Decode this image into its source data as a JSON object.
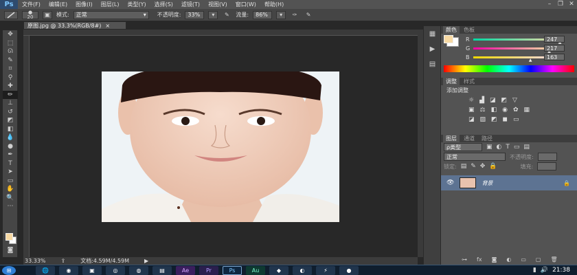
{
  "menubar": {
    "logo": "Ps",
    "items": [
      "文件(F)",
      "编辑(E)",
      "图像(I)",
      "图层(L)",
      "类型(Y)",
      "选择(S)",
      "滤镜(T)",
      "视图(V)",
      "窗口(W)",
      "帮助(H)"
    ],
    "window_buttons": [
      "–",
      "❐",
      "✕"
    ]
  },
  "options_bar": {
    "brush_size": "20",
    "mode_label": "模式:",
    "mode_value": "正常",
    "opacity_label": "不透明度:",
    "opacity_value": "33%",
    "flow_label": "流量:",
    "flow_value": "86%"
  },
  "document": {
    "tab_title": "原图.jpg @ 33.3%(RGB/8#)",
    "close": "×",
    "zoom": "33.33%",
    "doc_info": "文档:4.59M/4.59M"
  },
  "color_panel": {
    "tabs": [
      "颜色",
      "色板"
    ],
    "channels": [
      {
        "label": "R",
        "value": "247",
        "level": 0.97
      },
      {
        "label": "G",
        "value": "217",
        "level": 0.85
      },
      {
        "label": "B",
        "value": "163",
        "level": 0.64
      }
    ],
    "foreground": "#f7d9a3"
  },
  "adjustments_panel": {
    "tabs": [
      "调整",
      "样式"
    ],
    "title": "添加调整"
  },
  "layers_panel": {
    "tabs": [
      "图层",
      "通道",
      "路径"
    ],
    "filter_label": "ρ类型",
    "blend_mode": "正常",
    "opacity_label": "不透明度:",
    "lock_label": "锁定:",
    "fill_label": "填充:",
    "layer_name": "背景"
  },
  "taskbar": {
    "apps": [
      "Ae",
      "Pr",
      "Ps",
      "Au"
    ],
    "clock": "21:38"
  },
  "colors": {
    "accent": "#2e4b6e",
    "selected_layer": "#5d7392"
  }
}
